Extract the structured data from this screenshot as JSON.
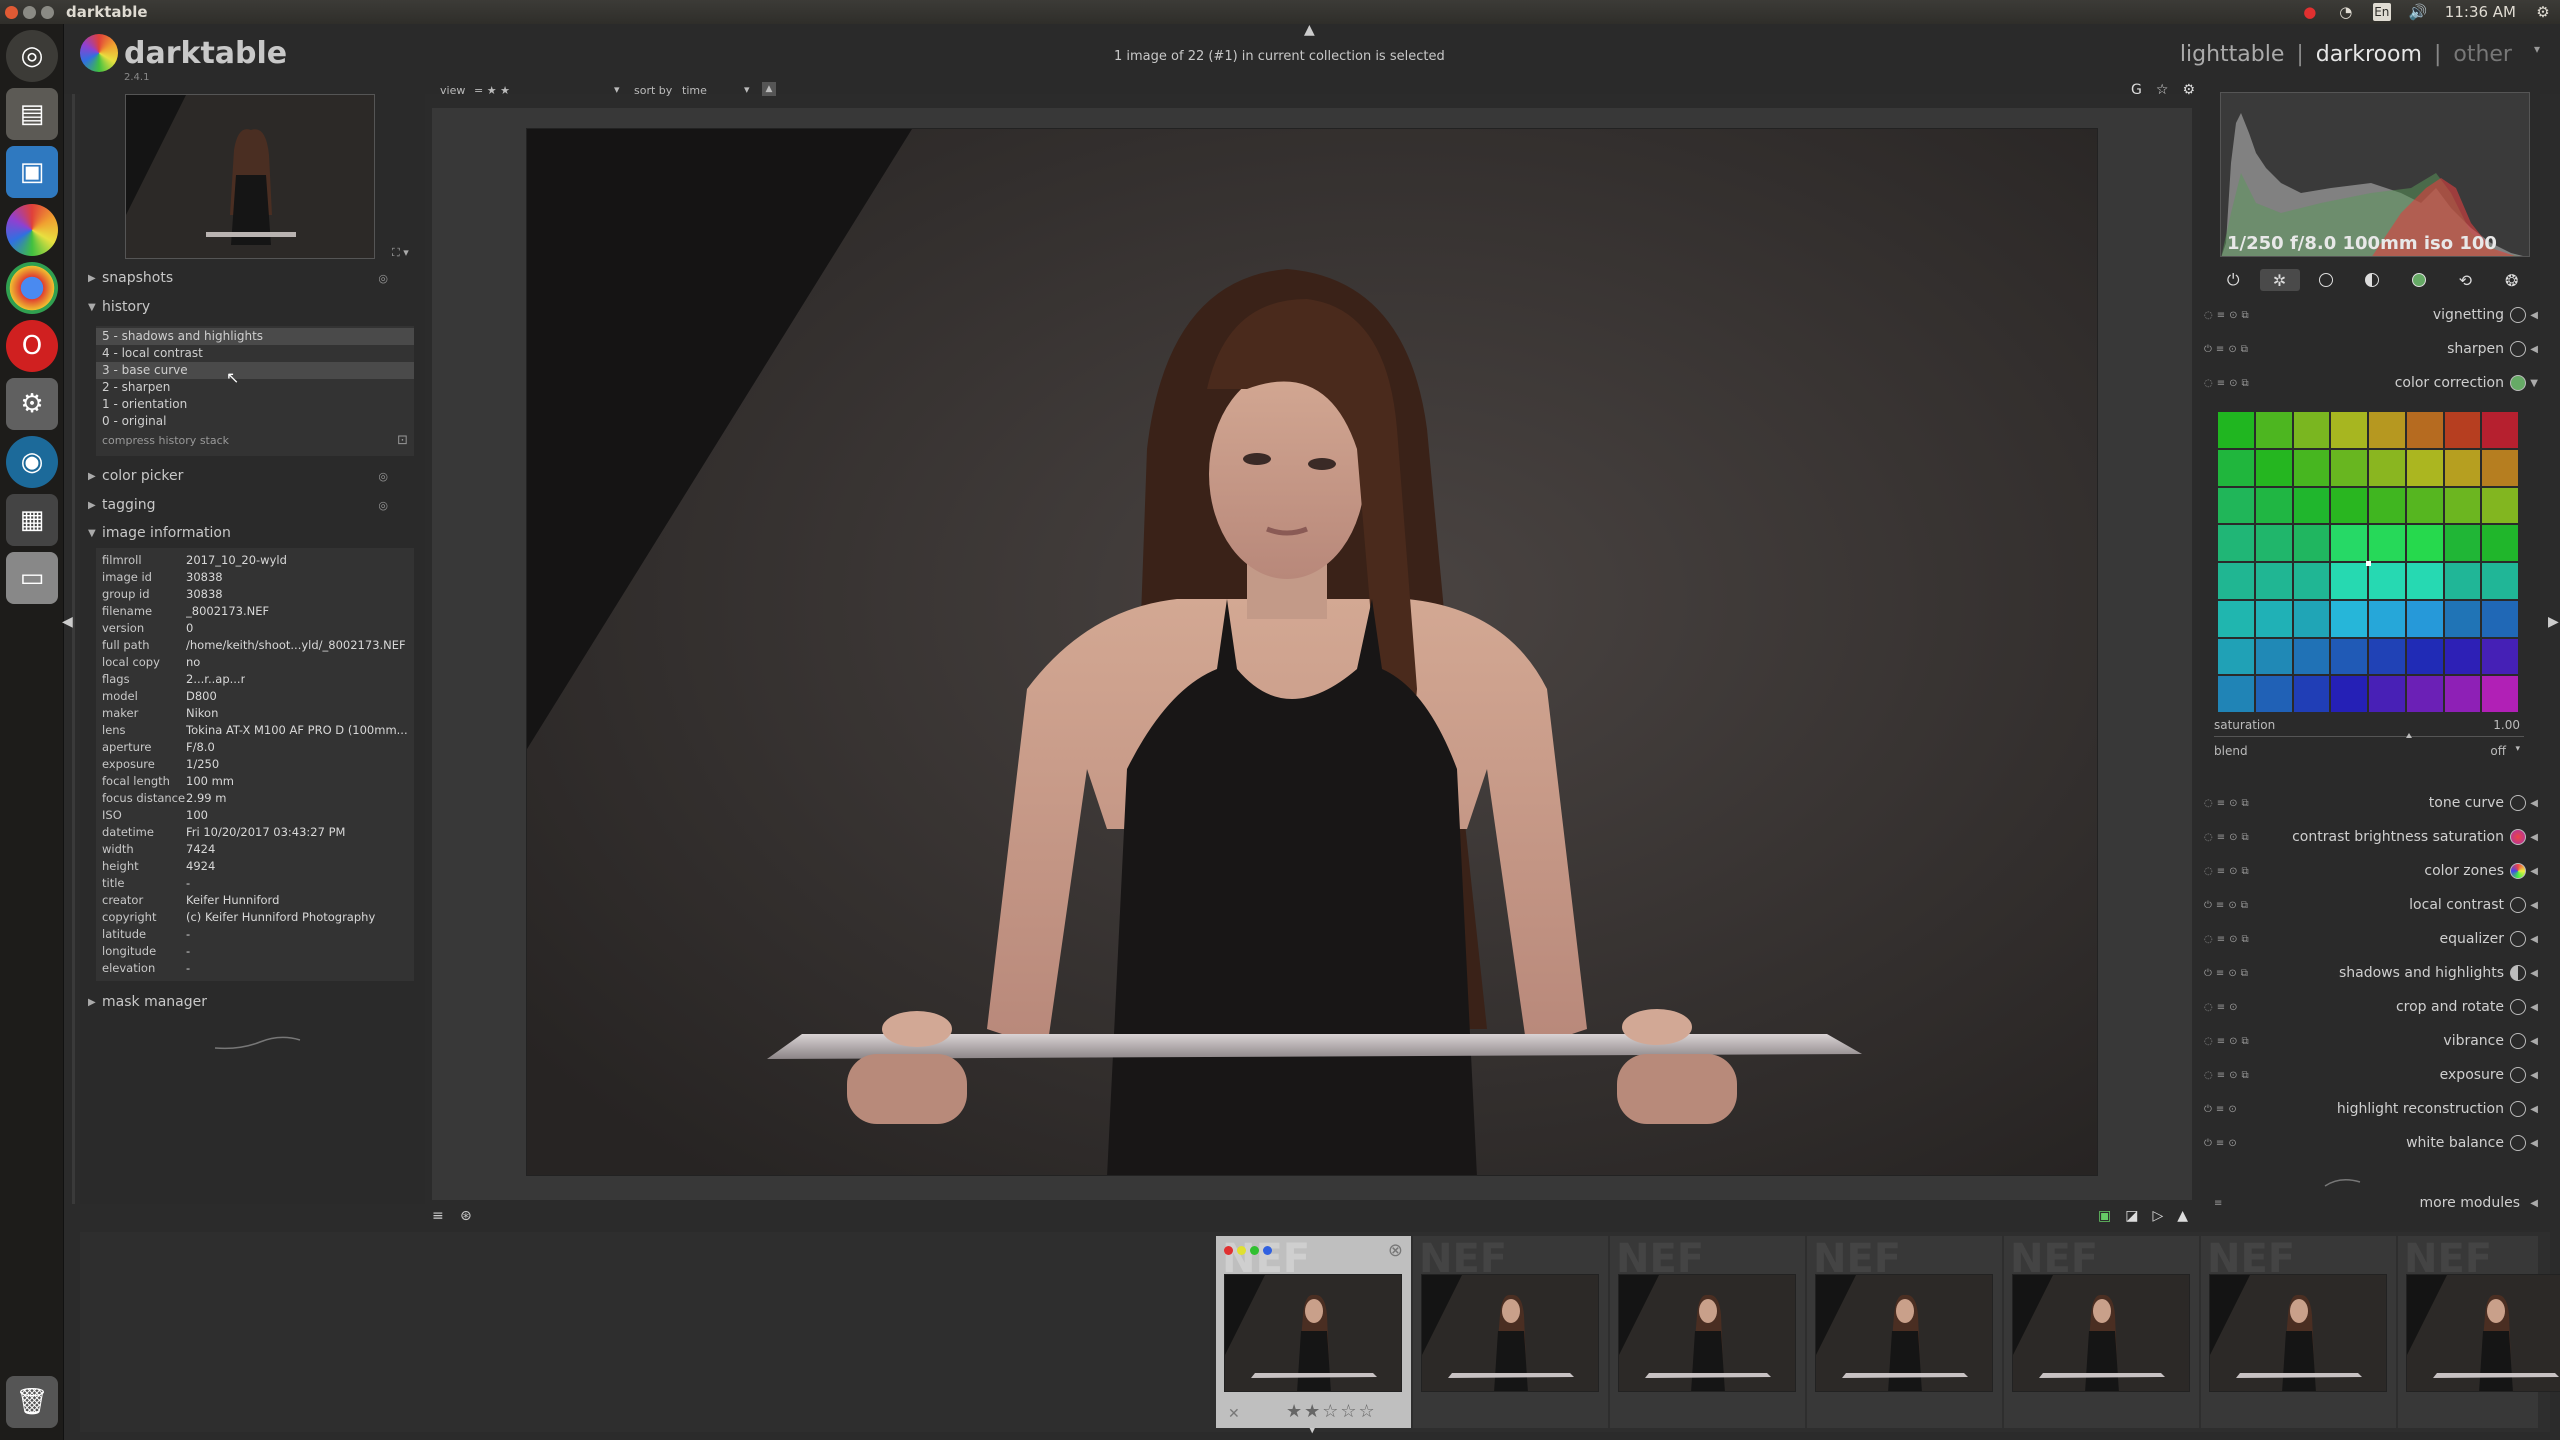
{
  "window": {
    "title": "darktable"
  },
  "tray": {
    "lang": "En",
    "clock": "11:36 AM"
  },
  "app": {
    "name": "darktable",
    "version": "2.4.1",
    "status_message": "1 image of 22 (#1) in current collection is selected"
  },
  "views": {
    "lighttable": "lighttable",
    "sep": "|",
    "darkroom": "darkroom",
    "other": "other"
  },
  "top_toolbar": {
    "view_label": "view",
    "view_value": "= ★ ★",
    "sort_label": "sort by",
    "sort_value": "time"
  },
  "left": {
    "snapshots": "snapshots",
    "history": "history",
    "history_items": [
      "5 - shadows and highlights",
      "4 - local contrast",
      "3 - base curve",
      "2 - sharpen",
      "1 - orientation",
      "0 - original"
    ],
    "compress": "compress history stack",
    "color_picker": "color picker",
    "tagging": "tagging",
    "image_information": "image information",
    "mask_manager": "mask manager",
    "info": [
      {
        "k": "filmroll",
        "v": "2017_10_20-wyld"
      },
      {
        "k": "image id",
        "v": "30838"
      },
      {
        "k": "group id",
        "v": "30838"
      },
      {
        "k": "filename",
        "v": "_8002173.NEF"
      },
      {
        "k": "version",
        "v": "0"
      },
      {
        "k": "full path",
        "v": "/home/keith/shoot...yld/_8002173.NEF"
      },
      {
        "k": "local copy",
        "v": "no"
      },
      {
        "k": "flags",
        "v": "2...r..ap...r"
      },
      {
        "k": "model",
        "v": "D800"
      },
      {
        "k": "maker",
        "v": "Nikon"
      },
      {
        "k": "lens",
        "v": "Tokina AT-X M100 AF PRO D (100mm..."
      },
      {
        "k": "aperture",
        "v": "F/8.0"
      },
      {
        "k": "exposure",
        "v": "1/250"
      },
      {
        "k": "focal length",
        "v": "100 mm"
      },
      {
        "k": "focus distance",
        "v": "2.99 m"
      },
      {
        "k": "ISO",
        "v": "100"
      },
      {
        "k": "datetime",
        "v": "Fri 10/20/2017 03:43:27 PM"
      },
      {
        "k": "width",
        "v": "7424"
      },
      {
        "k": "height",
        "v": "4924"
      },
      {
        "k": "title",
        "v": "-"
      },
      {
        "k": "creator",
        "v": "Keifer Hunniford"
      },
      {
        "k": "copyright",
        "v": "(c) Keifer Hunniford Photography"
      },
      {
        "k": "latitude",
        "v": "-"
      },
      {
        "k": "longitude",
        "v": "-"
      },
      {
        "k": "elevation",
        "v": "-"
      }
    ]
  },
  "right": {
    "hist_text": "1/250 f/8.0 100mm iso 100",
    "modules_top": [
      "vignetting",
      "sharpen",
      "color correction"
    ],
    "saturation_label": "saturation",
    "saturation_value": "1.00",
    "blend_label": "blend",
    "blend_value": "off",
    "modules": [
      "tone curve",
      "contrast brightness saturation",
      "color zones",
      "local contrast",
      "equalizer",
      "shadows and highlights",
      "crop and rotate",
      "vibrance",
      "exposure",
      "highlight reconstruction",
      "white balance"
    ],
    "more_modules": "more modules"
  },
  "filmstrip": {
    "nef": "NEF",
    "stars": "★★☆☆☆"
  }
}
